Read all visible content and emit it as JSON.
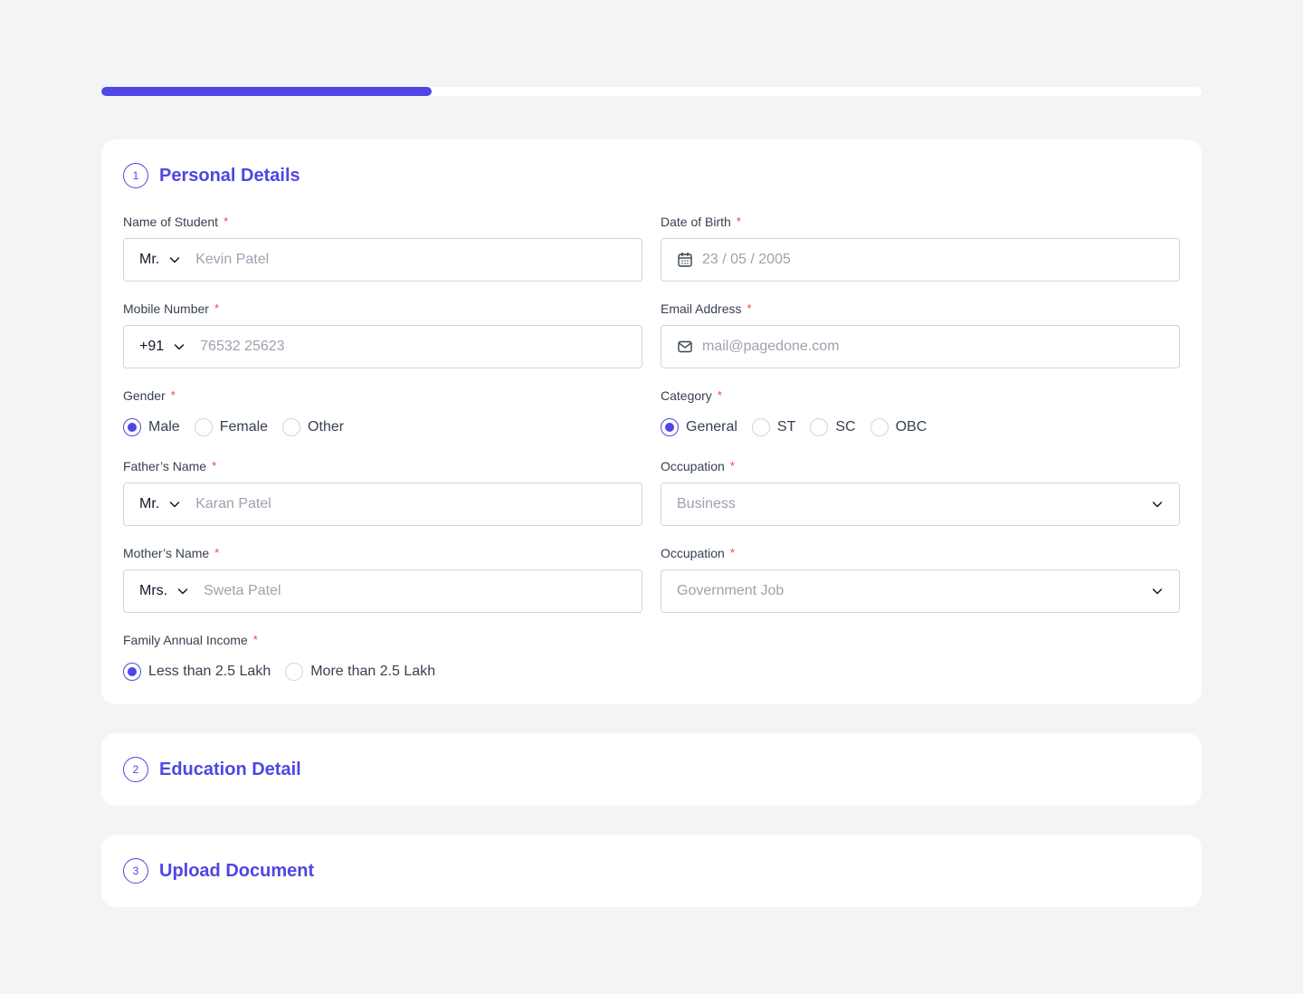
{
  "progress": {
    "fraction": 0.3
  },
  "sections": [
    {
      "number": "1",
      "title": "Personal Details"
    },
    {
      "number": "2",
      "title": "Education Detail"
    },
    {
      "number": "3",
      "title": "Upload Document"
    }
  ],
  "form": {
    "student_name": {
      "label": "Name of Student",
      "prefix": "Mr.",
      "placeholder": "Kevin Patel"
    },
    "dob": {
      "label": "Date of Birth",
      "placeholder": "23 / 05 / 2005"
    },
    "mobile": {
      "label": "Mobile Number",
      "prefix": "+91",
      "placeholder": "76532 25623"
    },
    "email": {
      "label": "Email Address",
      "placeholder": "mail@pagedone.com"
    },
    "gender": {
      "label": "Gender",
      "options": [
        "Male",
        "Female",
        "Other"
      ],
      "selected": "Male"
    },
    "category": {
      "label": "Category",
      "options": [
        "General",
        "ST",
        "SC",
        "OBC"
      ],
      "selected": "General"
    },
    "father_name": {
      "label": "Father’s Name",
      "prefix": "Mr.",
      "placeholder": "Karan Patel"
    },
    "father_occupation": {
      "label": "Occupation",
      "placeholder": "Business"
    },
    "mother_name": {
      "label": "Mother’s Name",
      "prefix": "Mrs.",
      "placeholder": "Sweta Patel"
    },
    "mother_occupation": {
      "label": "Occupation",
      "placeholder": "Government Job"
    },
    "income": {
      "label": "Family Annual Income",
      "options": [
        "Less than 2.5 Lakh",
        "More than 2.5 Lakh"
      ],
      "selected": "Less than 2.5 Lakh"
    }
  },
  "required_mark": "*",
  "colors": {
    "accent": "#4f46e5",
    "required": "#ef4444",
    "background": "#f3f4f6"
  }
}
